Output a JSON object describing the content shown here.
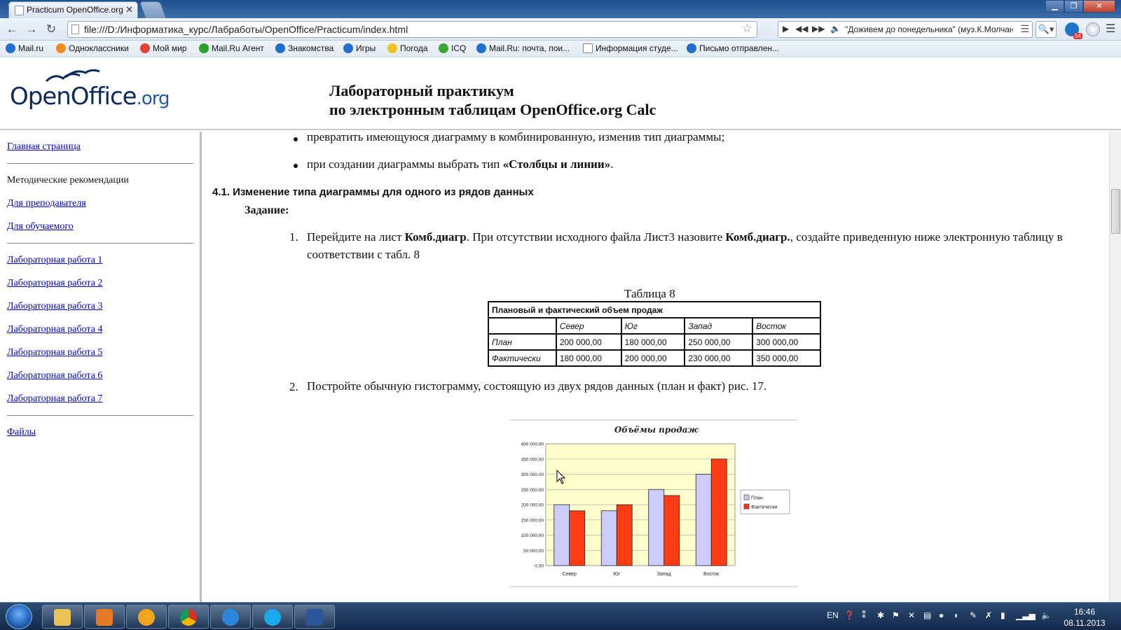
{
  "browser": {
    "tab_title": "Practicum OpenOffice.org",
    "tab_close": "✕",
    "url": "file:///D:/Информатика_курс/Лабработы/OpenOffice/Practicum/index.html",
    "player_track": "\"Доживем до понедельника\" (муз.К.Молчан",
    "bookmarks": [
      {
        "label": "Mail.ru",
        "color": "#1f6fd0"
      },
      {
        "label": "Одноклассники",
        "color": "#f08a1c"
      },
      {
        "label": "Мой мир",
        "color": "#e2452f"
      },
      {
        "label": "Mail.Ru Агент",
        "color": "#2aa12a"
      },
      {
        "label": "Знакомства",
        "color": "#1f6fd0"
      },
      {
        "label": "Игры",
        "color": "#1f6fd0"
      },
      {
        "label": "Погода",
        "color": "#f0c020"
      },
      {
        "label": "ICQ",
        "color": "#3aa530"
      },
      {
        "label": "Mail.Ru: почта, пои...",
        "color": "#1f6fd0"
      },
      {
        "label": "Информация студе...",
        "color": "#ffffff"
      },
      {
        "label": "Письмо отправлен...",
        "color": "#1f6fd0"
      }
    ],
    "ext_badge": "54"
  },
  "header": {
    "logo_main": "OpenOffice",
    "logo_org": ".org",
    "title_line1": "Лабораторный практикум",
    "title_line2": "по электронным таблицам OpenOffice.org Calc"
  },
  "sidebar": {
    "home": "Главная страница",
    "methodical": "Методические рекомендации",
    "teacher": "Для преподавателя",
    "student": "Для обучаемого",
    "labs": [
      "Лабораторная работа 1",
      "Лабораторная работа 2",
      "Лабораторная работа 3",
      "Лабораторная работа 4",
      "Лабораторная работа 5",
      "Лабораторная работа 6",
      "Лабораторная работа 7"
    ],
    "files": "Файлы"
  },
  "content": {
    "bullet1": "превратить имеющуюся диаграмму в комбинированную, изменив тип диаграммы;",
    "bullet2_pre": "при создании диаграммы выбрать тип ",
    "bullet2_bold": "«Столбцы и линии»",
    "bullet2_post": ".",
    "section_heading": "4.1. Изменение типа диаграммы для одного из рядов данных",
    "task_label": "Задание:",
    "step1_num": "1.",
    "step1_a": "Перейдите на лист ",
    "step1_b": "Комб.диагр",
    "step1_c": ". При отсутствии исходного файла Лист3 назовите ",
    "step1_d": "Комб.диагр.",
    "step1_e": ", создайте приведенную ниже электронную таблицу в соответствии с табл. 8",
    "table_caption": "Таблица 8",
    "step2_num": "2.",
    "step2": "Постройте обычную гистограмму, состоящую из двух рядов данных (план и факт) рис. 17."
  },
  "table": {
    "title": "Плановый и фактический объем продаж",
    "headers": [
      "",
      "Север",
      "Юг",
      "Запад",
      "Восток"
    ],
    "rows": [
      [
        "План",
        "200 000,00",
        "180 000,00",
        "250 000,00",
        "300 000,00"
      ],
      [
        "Фактически",
        "180 000,00",
        "200 000,00",
        "230 000,00",
        "350 000,00"
      ]
    ]
  },
  "chart_data": {
    "type": "bar",
    "title": "Объёмы продаж",
    "categories": [
      "Север",
      "Юг",
      "Запад",
      "Восток"
    ],
    "series": [
      {
        "name": "План",
        "values": [
          200000,
          180000,
          250000,
          300000
        ],
        "color": "#ccccff"
      },
      {
        "name": "Фактически",
        "values": [
          180000,
          200000,
          230000,
          350000
        ],
        "color": "#ff3c14"
      }
    ],
    "ylim": [
      0,
      400000
    ],
    "yticks": [
      "0,00",
      "50 000,00",
      "100 000,00",
      "150 000,00",
      "200 000,00",
      "250 000,00",
      "300 000,00",
      "350 000,00",
      "400 000,00"
    ],
    "plot_background": "#ffffcc",
    "grid": true,
    "legend": "right"
  },
  "taskbar": {
    "lang": "EN",
    "time": "16:46",
    "date": "08.11.2013"
  }
}
